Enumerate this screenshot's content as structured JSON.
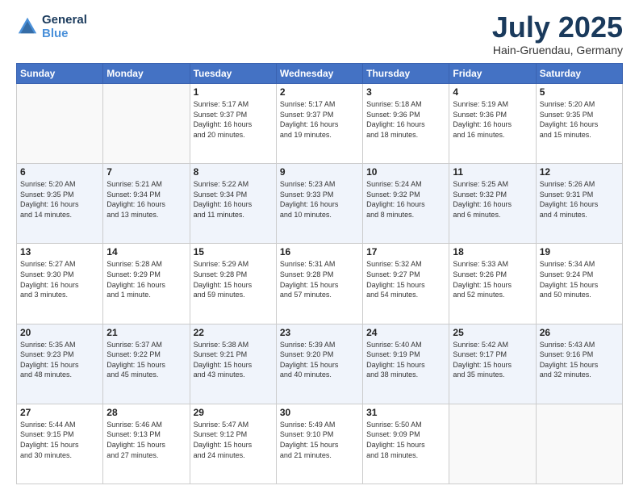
{
  "header": {
    "logo_line1": "General",
    "logo_line2": "Blue",
    "month": "July 2025",
    "location": "Hain-Gruendau, Germany"
  },
  "days_of_week": [
    "Sunday",
    "Monday",
    "Tuesday",
    "Wednesday",
    "Thursday",
    "Friday",
    "Saturday"
  ],
  "weeks": [
    [
      {
        "day": "",
        "info": ""
      },
      {
        "day": "",
        "info": ""
      },
      {
        "day": "1",
        "info": "Sunrise: 5:17 AM\nSunset: 9:37 PM\nDaylight: 16 hours\nand 20 minutes."
      },
      {
        "day": "2",
        "info": "Sunrise: 5:17 AM\nSunset: 9:37 PM\nDaylight: 16 hours\nand 19 minutes."
      },
      {
        "day": "3",
        "info": "Sunrise: 5:18 AM\nSunset: 9:36 PM\nDaylight: 16 hours\nand 18 minutes."
      },
      {
        "day": "4",
        "info": "Sunrise: 5:19 AM\nSunset: 9:36 PM\nDaylight: 16 hours\nand 16 minutes."
      },
      {
        "day": "5",
        "info": "Sunrise: 5:20 AM\nSunset: 9:35 PM\nDaylight: 16 hours\nand 15 minutes."
      }
    ],
    [
      {
        "day": "6",
        "info": "Sunrise: 5:20 AM\nSunset: 9:35 PM\nDaylight: 16 hours\nand 14 minutes."
      },
      {
        "day": "7",
        "info": "Sunrise: 5:21 AM\nSunset: 9:34 PM\nDaylight: 16 hours\nand 13 minutes."
      },
      {
        "day": "8",
        "info": "Sunrise: 5:22 AM\nSunset: 9:34 PM\nDaylight: 16 hours\nand 11 minutes."
      },
      {
        "day": "9",
        "info": "Sunrise: 5:23 AM\nSunset: 9:33 PM\nDaylight: 16 hours\nand 10 minutes."
      },
      {
        "day": "10",
        "info": "Sunrise: 5:24 AM\nSunset: 9:32 PM\nDaylight: 16 hours\nand 8 minutes."
      },
      {
        "day": "11",
        "info": "Sunrise: 5:25 AM\nSunset: 9:32 PM\nDaylight: 16 hours\nand 6 minutes."
      },
      {
        "day": "12",
        "info": "Sunrise: 5:26 AM\nSunset: 9:31 PM\nDaylight: 16 hours\nand 4 minutes."
      }
    ],
    [
      {
        "day": "13",
        "info": "Sunrise: 5:27 AM\nSunset: 9:30 PM\nDaylight: 16 hours\nand 3 minutes."
      },
      {
        "day": "14",
        "info": "Sunrise: 5:28 AM\nSunset: 9:29 PM\nDaylight: 16 hours\nand 1 minute."
      },
      {
        "day": "15",
        "info": "Sunrise: 5:29 AM\nSunset: 9:28 PM\nDaylight: 15 hours\nand 59 minutes."
      },
      {
        "day": "16",
        "info": "Sunrise: 5:31 AM\nSunset: 9:28 PM\nDaylight: 15 hours\nand 57 minutes."
      },
      {
        "day": "17",
        "info": "Sunrise: 5:32 AM\nSunset: 9:27 PM\nDaylight: 15 hours\nand 54 minutes."
      },
      {
        "day": "18",
        "info": "Sunrise: 5:33 AM\nSunset: 9:26 PM\nDaylight: 15 hours\nand 52 minutes."
      },
      {
        "day": "19",
        "info": "Sunrise: 5:34 AM\nSunset: 9:24 PM\nDaylight: 15 hours\nand 50 minutes."
      }
    ],
    [
      {
        "day": "20",
        "info": "Sunrise: 5:35 AM\nSunset: 9:23 PM\nDaylight: 15 hours\nand 48 minutes."
      },
      {
        "day": "21",
        "info": "Sunrise: 5:37 AM\nSunset: 9:22 PM\nDaylight: 15 hours\nand 45 minutes."
      },
      {
        "day": "22",
        "info": "Sunrise: 5:38 AM\nSunset: 9:21 PM\nDaylight: 15 hours\nand 43 minutes."
      },
      {
        "day": "23",
        "info": "Sunrise: 5:39 AM\nSunset: 9:20 PM\nDaylight: 15 hours\nand 40 minutes."
      },
      {
        "day": "24",
        "info": "Sunrise: 5:40 AM\nSunset: 9:19 PM\nDaylight: 15 hours\nand 38 minutes."
      },
      {
        "day": "25",
        "info": "Sunrise: 5:42 AM\nSunset: 9:17 PM\nDaylight: 15 hours\nand 35 minutes."
      },
      {
        "day": "26",
        "info": "Sunrise: 5:43 AM\nSunset: 9:16 PM\nDaylight: 15 hours\nand 32 minutes."
      }
    ],
    [
      {
        "day": "27",
        "info": "Sunrise: 5:44 AM\nSunset: 9:15 PM\nDaylight: 15 hours\nand 30 minutes."
      },
      {
        "day": "28",
        "info": "Sunrise: 5:46 AM\nSunset: 9:13 PM\nDaylight: 15 hours\nand 27 minutes."
      },
      {
        "day": "29",
        "info": "Sunrise: 5:47 AM\nSunset: 9:12 PM\nDaylight: 15 hours\nand 24 minutes."
      },
      {
        "day": "30",
        "info": "Sunrise: 5:49 AM\nSunset: 9:10 PM\nDaylight: 15 hours\nand 21 minutes."
      },
      {
        "day": "31",
        "info": "Sunrise: 5:50 AM\nSunset: 9:09 PM\nDaylight: 15 hours\nand 18 minutes."
      },
      {
        "day": "",
        "info": ""
      },
      {
        "day": "",
        "info": ""
      }
    ]
  ]
}
